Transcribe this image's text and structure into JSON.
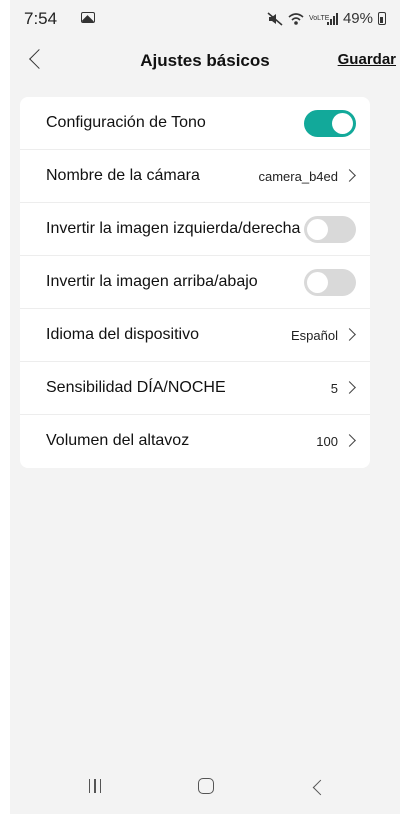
{
  "status_bar": {
    "time": "7:54",
    "lte_label": "VoLTE",
    "battery": "49%"
  },
  "header": {
    "title": "Ajustes básicos",
    "save_label": "Guardar"
  },
  "settings": {
    "tone": {
      "label": "Configuración de Tono",
      "enabled": true
    },
    "camera_name": {
      "label": "Nombre de la cámara",
      "value": "camera_b4ed"
    },
    "flip_horizontal": {
      "label": "Invertir la imagen izquierda/derecha",
      "enabled": false
    },
    "flip_vertical": {
      "label": "Invertir la imagen arriba/abajo",
      "enabled": false
    },
    "device_language": {
      "label": "Idioma del dispositivo",
      "value": "Español"
    },
    "day_night_sensitivity": {
      "label": "Sensibilidad DÍA/NOCHE",
      "value": "5"
    },
    "speaker_volume": {
      "label": "Volumen del altavoz",
      "value": "100"
    }
  },
  "colors": {
    "toggle_on": "#12a99a",
    "toggle_off": "#d9d9d9",
    "background": "#f3f3f3",
    "card": "#ffffff"
  },
  "icons": [
    "gallery-icon",
    "mute-icon",
    "wifi-icon",
    "signal-icon",
    "battery-icon",
    "back-icon",
    "chevron-right-icon",
    "recent-apps-icon",
    "home-icon",
    "nav-back-icon"
  ]
}
